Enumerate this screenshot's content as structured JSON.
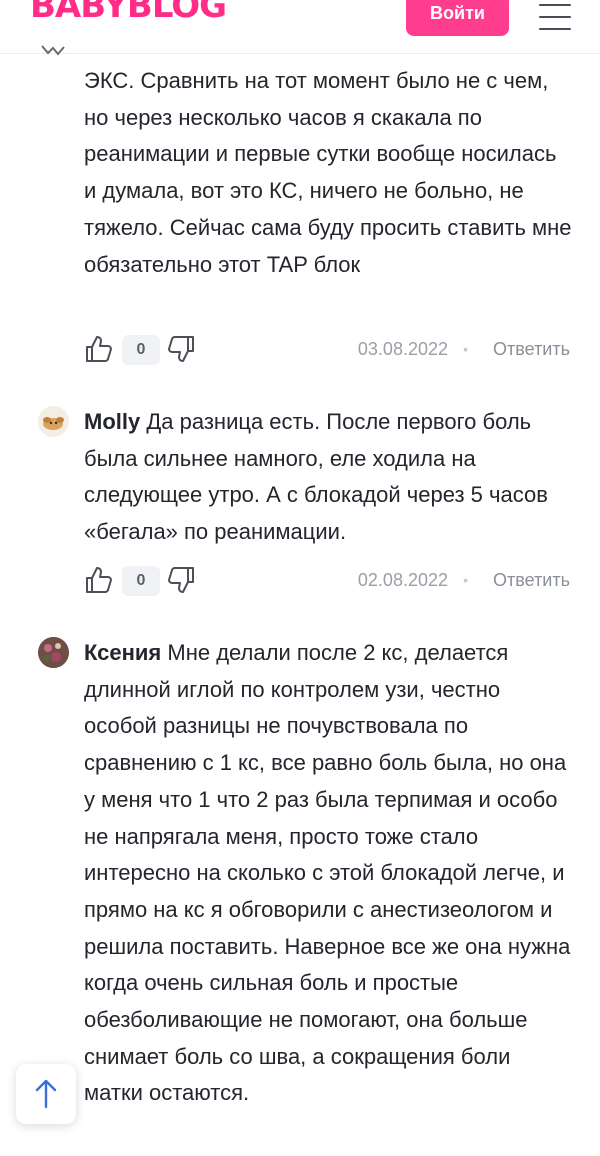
{
  "header": {
    "logo_text": "BABYBLOG",
    "login_label": "Войти",
    "menu_icon": "hamburger-menu-icon",
    "brand_color": "#ff2d87"
  },
  "comments": [
    {
      "author": "",
      "text": "ЭКС. Сравнить на тот момент было не с чем, но через несколько часов я скакала по реанимации и первые сутки вообще носилась и думала, вот это КС, ничего не больно, не тяжело. Сейчас сама буду просить ставить мне обязательно этот TAP блок",
      "votes": "0",
      "date": "03.08.2022",
      "reply_label": "Ответить"
    },
    {
      "author": "Molly",
      "text": "Да разница есть. После первого боль была сильнее намного, еле ходила на следующее утро. А с блокадой через 5 часов «бегала» по реанимации.",
      "votes": "0",
      "date": "02.08.2022",
      "reply_label": "Ответить"
    },
    {
      "author": "Ксения",
      "text": "Мне делали после 2 кс, делается длинной иглой по контролем узи, честно особой разницы не почувствовала по сравнению с 1 кс, все равно боль была, но она у меня что 1 что 2 раз была терпимая и особо не напрягала меня, просто тоже стало интересно на сколько с этой блокадой легче, и прямо на кс я обговорили с анестизеологом и решила поставить. Наверное все же она нужна когда очень сильная боль и простые обезболивающие не помогают, она больше снимает боль со шва, а сокращения боли матки остаются."
    }
  ],
  "scroll_top_icon": "arrow-up-icon",
  "separator": "•"
}
